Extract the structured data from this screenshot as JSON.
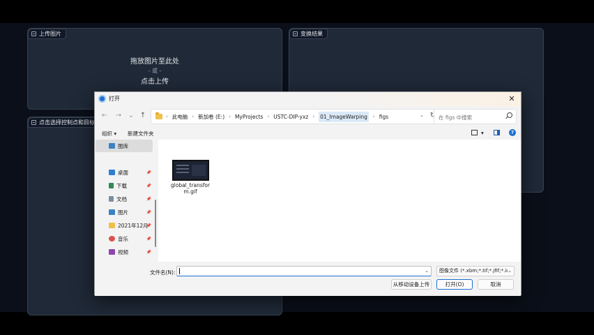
{
  "app": {
    "upload_panel_label": "上传图片",
    "drop_text": "拖放图片至此处",
    "or_text": "- 或 -",
    "click_upload": "点击上传",
    "result_panel_label": "变换结果",
    "select_panel_label": "点击选择控制点和目标点"
  },
  "dialog": {
    "title": "打开",
    "close_symbol": "✕",
    "nav": {
      "back": "←",
      "forward": "→",
      "recent": "⌄",
      "up": "↑",
      "refresh": "↻"
    },
    "breadcrumb": [
      "此电脑",
      "新加卷 (E:)",
      "MyProjects",
      "USTC-DIP-yxz",
      "01_ImageWarping",
      "figs"
    ],
    "breadcrumb_sep": "›",
    "search_placeholder": "在 figs 中搜索",
    "toolbar": {
      "organize": "组织 ▾",
      "new_folder": "新建文件夹",
      "view_menu": "▾",
      "help": "?"
    },
    "sidebar": [
      {
        "label": "图库",
        "icon": "gallery-icon",
        "color": "#3b82c4",
        "pinned": false,
        "selected": true
      },
      {
        "label": "桌面",
        "icon": "desktop-icon",
        "color": "#2f7fd1",
        "pinned": true
      },
      {
        "label": "下载",
        "icon": "download-icon",
        "color": "#2e8b57",
        "pinned": true
      },
      {
        "label": "文档",
        "icon": "document-icon",
        "color": "#7d8ea3",
        "pinned": true
      },
      {
        "label": "图片",
        "icon": "pictures-icon",
        "color": "#3b82c4",
        "pinned": true
      },
      {
        "label": "2021年12月",
        "icon": "folder-icon",
        "color": "#f0c04a",
        "pinned": true
      },
      {
        "label": "音乐",
        "icon": "music-icon",
        "color": "#d9534f",
        "pinned": true
      },
      {
        "label": "视频",
        "icon": "video-icon",
        "color": "#8e44ad",
        "pinned": true
      }
    ],
    "pin_symbol": "📌",
    "files": [
      {
        "name": "global_transform.gif"
      }
    ],
    "filename_label": "文件名(N):",
    "filename_value": "",
    "filetype": "图像文件 (*.xbm;*.tif;*.jfif;*.ico",
    "buttons": {
      "mobile_upload": "从移动设备上传",
      "open": "打开(O)",
      "cancel": "取消"
    }
  }
}
